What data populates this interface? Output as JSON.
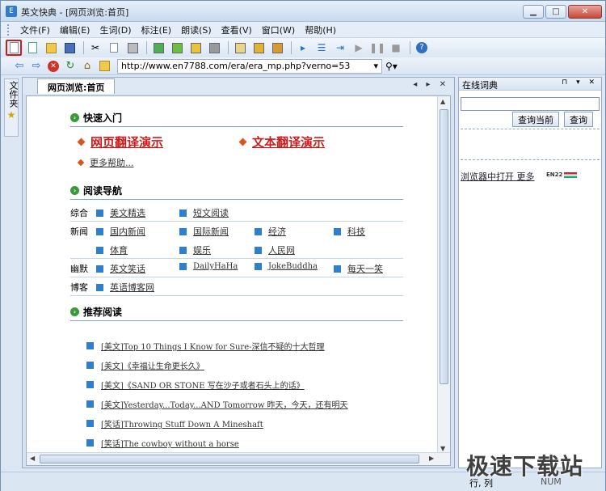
{
  "window": {
    "title": "英文快典 - [网页浏览:首页]",
    "controls": {
      "minimize": "▁",
      "maximize": "□",
      "close": "✕"
    }
  },
  "menubar": {
    "items": [
      "文件(F)",
      "编辑(E)",
      "生词(D)",
      "标注(E)",
      "朗读(S)",
      "查看(V)",
      "窗口(W)",
      "帮助(H)"
    ]
  },
  "toolbar1": {
    "icons": [
      "new-document-icon",
      "copy-document-icon",
      "open-folder-icon",
      "save-icon",
      "cut-icon",
      "copy-icon",
      "paste-icon",
      "mark-green-icon",
      "mark-green-2-icon",
      "mark-yellow-icon",
      "mark-gray-icon",
      "list-icon",
      "highlight-icon",
      "highlight-x-icon",
      "read-start-icon",
      "read-line-icon",
      "read-select-icon",
      "play-icon",
      "pause-icon",
      "stop-icon",
      "help-icon"
    ]
  },
  "toolbar2": {
    "url": "http://www.en7788.com/era/era_mp.php?verno=53",
    "back": "⇦",
    "forward": "⇨",
    "stop": "✕",
    "refresh": "↻",
    "home": "⌂",
    "go": "⚲▾"
  },
  "sidebar": {
    "tab_label": "文件夹",
    "star": "★"
  },
  "doc": {
    "tab_label": "网页浏览:首页",
    "tab_controls": "◂ ▸ ✕",
    "quick_start": {
      "heading": "快速入门",
      "link1": "网页翻译演示",
      "link2": "文本翻译演示",
      "more": "更多帮助..."
    },
    "reading_nav": {
      "heading": "阅读导航",
      "rows": [
        {
          "category": "综合",
          "links": [
            "美文精选",
            "短文阅读"
          ]
        },
        {
          "category": "新闻",
          "links": [
            "国内新闻",
            "国际新闻",
            "经济",
            "科技"
          ]
        },
        {
          "category": "",
          "links": [
            "体育",
            "娱乐",
            "人民网"
          ]
        },
        {
          "category": "幽默",
          "links": [
            "英文笑话",
            "DailyHaHa",
            "JokeBuddha",
            "每天一笑"
          ]
        },
        {
          "category": "博客",
          "links": [
            "英语博客网"
          ]
        }
      ]
    },
    "recommended": {
      "heading": "推荐阅读",
      "items": [
        "[美文]Top 10 Things I Know for Sure-深信不疑的十大哲理",
        "[美文]《幸福让生命更长久》",
        "[美文]《SAND OR STONE 写在沙子或者石头上的话》",
        "[美文]Yesterday...Today...AND Tomorrow 昨天，今天，还有明天",
        "[笑话]Throwing Stuff Down A Mineshaft",
        "[笑话]The cowboy without a horse"
      ]
    }
  },
  "dict_panel": {
    "title": "在线词典",
    "controls": "⊓ ▾ ✕",
    "query_current": "查询当前",
    "query": "查询",
    "open_in_browser": "浏览器中打开 更多",
    "badge": "EN22"
  },
  "statusbar": {
    "row_col": "行, 列",
    "num": "NUM"
  },
  "watermark": "极速下载站"
}
